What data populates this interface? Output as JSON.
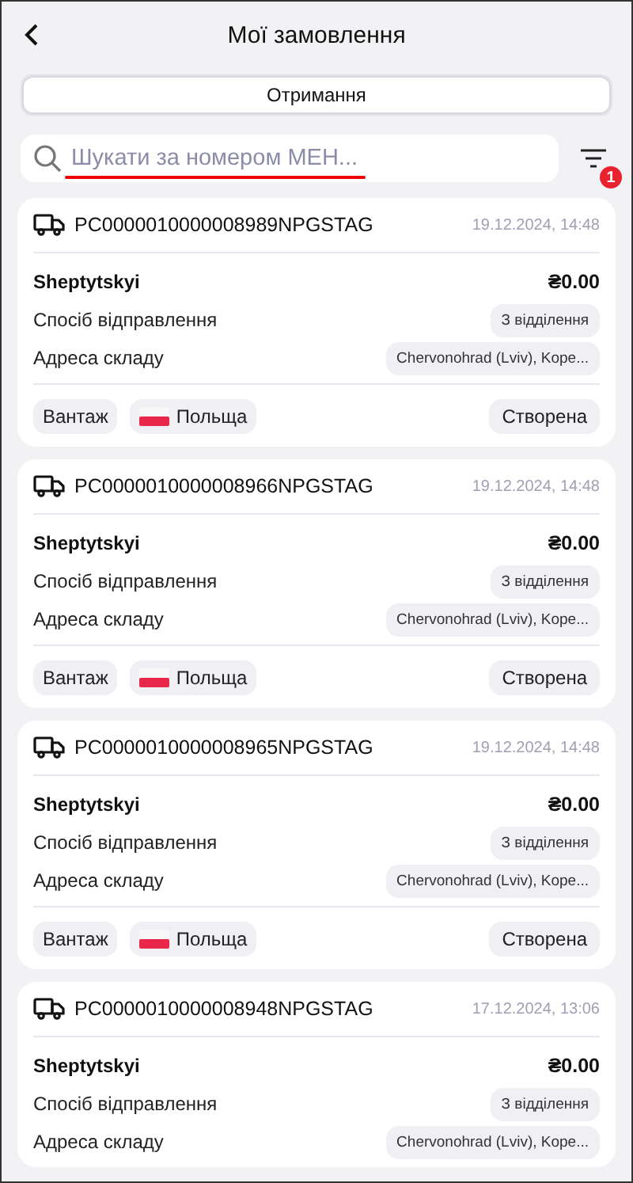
{
  "header": {
    "title": "Мої замовлення"
  },
  "tabs": [
    {
      "label": "Отримання",
      "selected": true
    }
  ],
  "search": {
    "placeholder": "Шукати за номером МЕН...",
    "highlighted": true
  },
  "filter": {
    "badge": "1"
  },
  "orders": [
    {
      "number": "PC0000010000008989NPGSTAG",
      "date": "19.12.2024, 14:48",
      "name": "Sheptytskyi",
      "amount": "₴0.00",
      "fields": [
        {
          "label": "Спосіб відправлення",
          "value": "З відділення"
        },
        {
          "label": "Адреса складу",
          "value": "Chervonohrad (Lviv), Kope..."
        }
      ],
      "tags": [
        {
          "label": "Вантаж"
        },
        {
          "label": "Польща",
          "flag": true
        }
      ],
      "status": "Створена"
    },
    {
      "number": "PC0000010000008966NPGSTAG",
      "date": "19.12.2024, 14:48",
      "name": "Sheptytskyi",
      "amount": "₴0.00",
      "fields": [
        {
          "label": "Спосіб відправлення",
          "value": "З відділення"
        },
        {
          "label": "Адреса складу",
          "value": "Chervonohrad (Lviv), Kope..."
        }
      ],
      "tags": [
        {
          "label": "Вантаж"
        },
        {
          "label": "Польща",
          "flag": true
        }
      ],
      "status": "Створена"
    },
    {
      "number": "PC0000010000008965NPGSTAG",
      "date": "19.12.2024, 14:48",
      "name": "Sheptytskyi",
      "amount": "₴0.00",
      "fields": [
        {
          "label": "Спосіб відправлення",
          "value": "З відділення"
        },
        {
          "label": "Адреса складу",
          "value": "Chervonohrad (Lviv), Kope..."
        }
      ],
      "tags": [
        {
          "label": "Вантаж"
        },
        {
          "label": "Польща",
          "flag": true
        }
      ],
      "status": "Створена"
    },
    {
      "number": "PC0000010000008948NPGSTAG",
      "date": "17.12.2024, 13:06",
      "name": "Sheptytskyi",
      "amount": "₴0.00",
      "fields": [
        {
          "label": "Спосіб відправлення",
          "value": "З відділення"
        },
        {
          "label": "Адреса складу",
          "value": "Chervonohrad (Lviv), Kope..."
        }
      ]
    }
  ]
}
